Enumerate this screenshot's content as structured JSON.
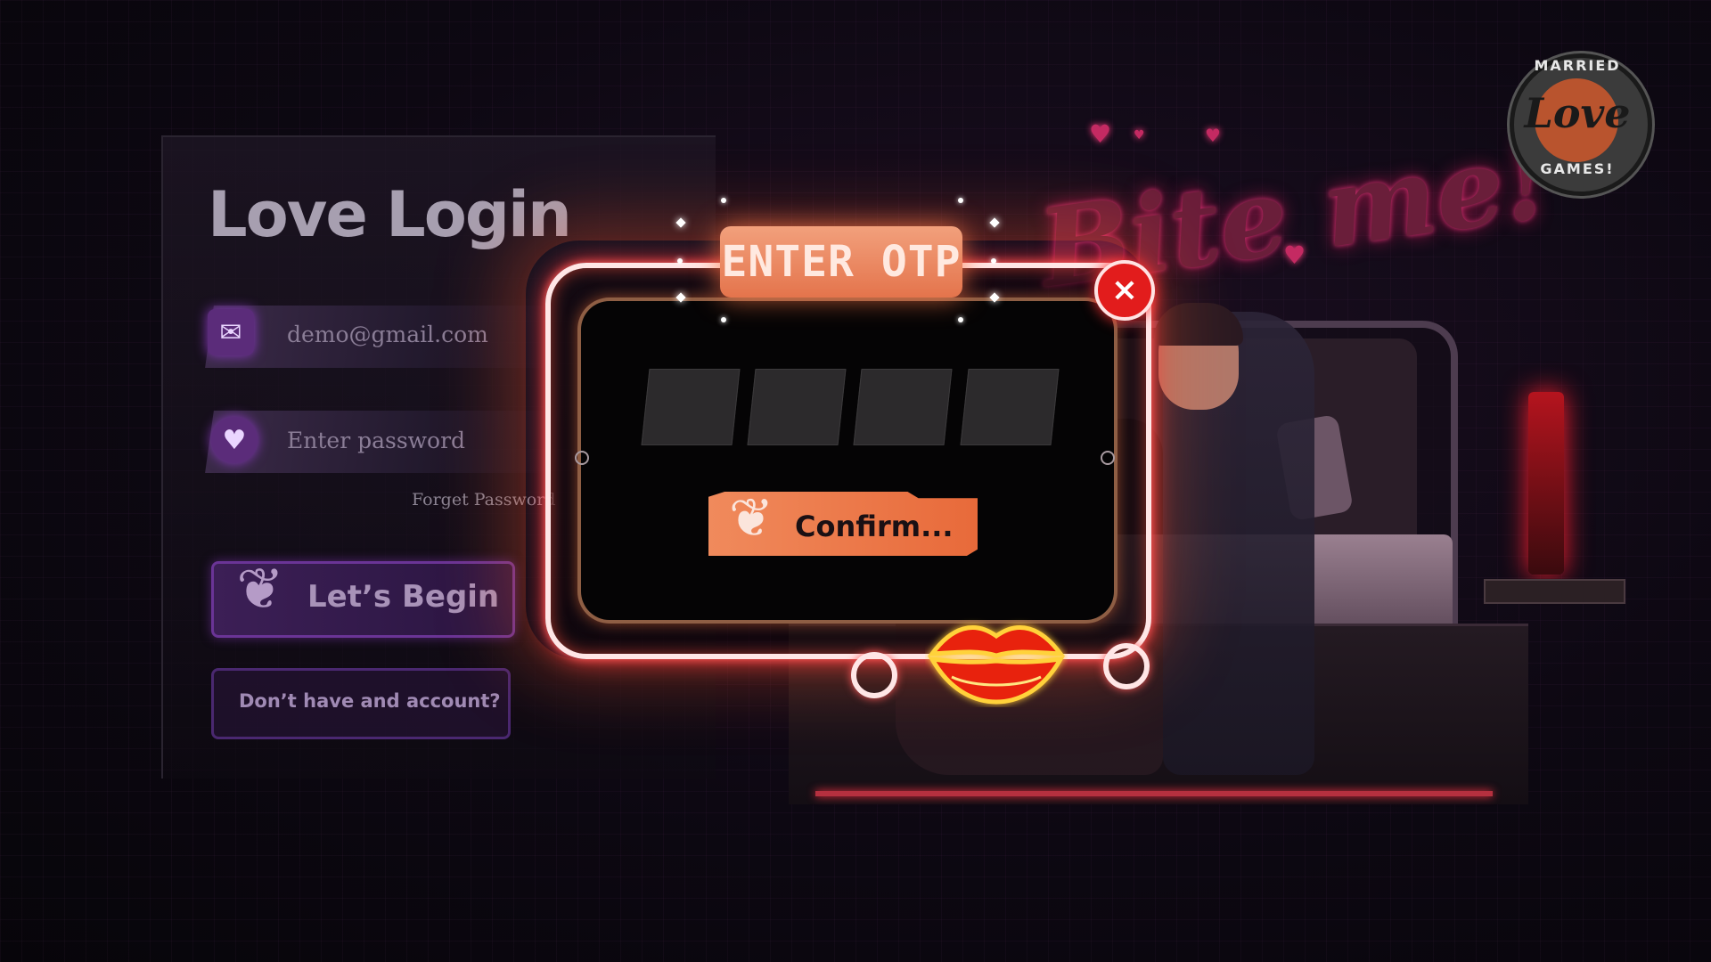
{
  "login": {
    "title": "Love Login",
    "email_value": "demo@gmail.com",
    "password_placeholder": "Enter password",
    "forgot_label": "Forget Password",
    "begin_label": "Let’s Begin",
    "account_label": "Don’t have and account?"
  },
  "modal": {
    "title": "ENTER OTP",
    "close_glyph": "×",
    "otp_digits": [
      "",
      "",
      "",
      ""
    ],
    "confirm_label": "Confirm..."
  },
  "scene": {
    "neon_text": "Bite me!"
  },
  "logo": {
    "top_text": "MARRIED",
    "main_text": "Love",
    "bottom_text": "GAMES!"
  },
  "icons": {
    "email": "envelope-icon",
    "password": "lock-heart-icon",
    "couple": "couple-icon",
    "close": "close-icon",
    "lips": "lips-icon"
  },
  "colors": {
    "accent_orange": "#e86a3a",
    "neon_white": "#ffe6e6",
    "close_red": "#e21c1c",
    "login_purple": "#5b2c7a"
  }
}
